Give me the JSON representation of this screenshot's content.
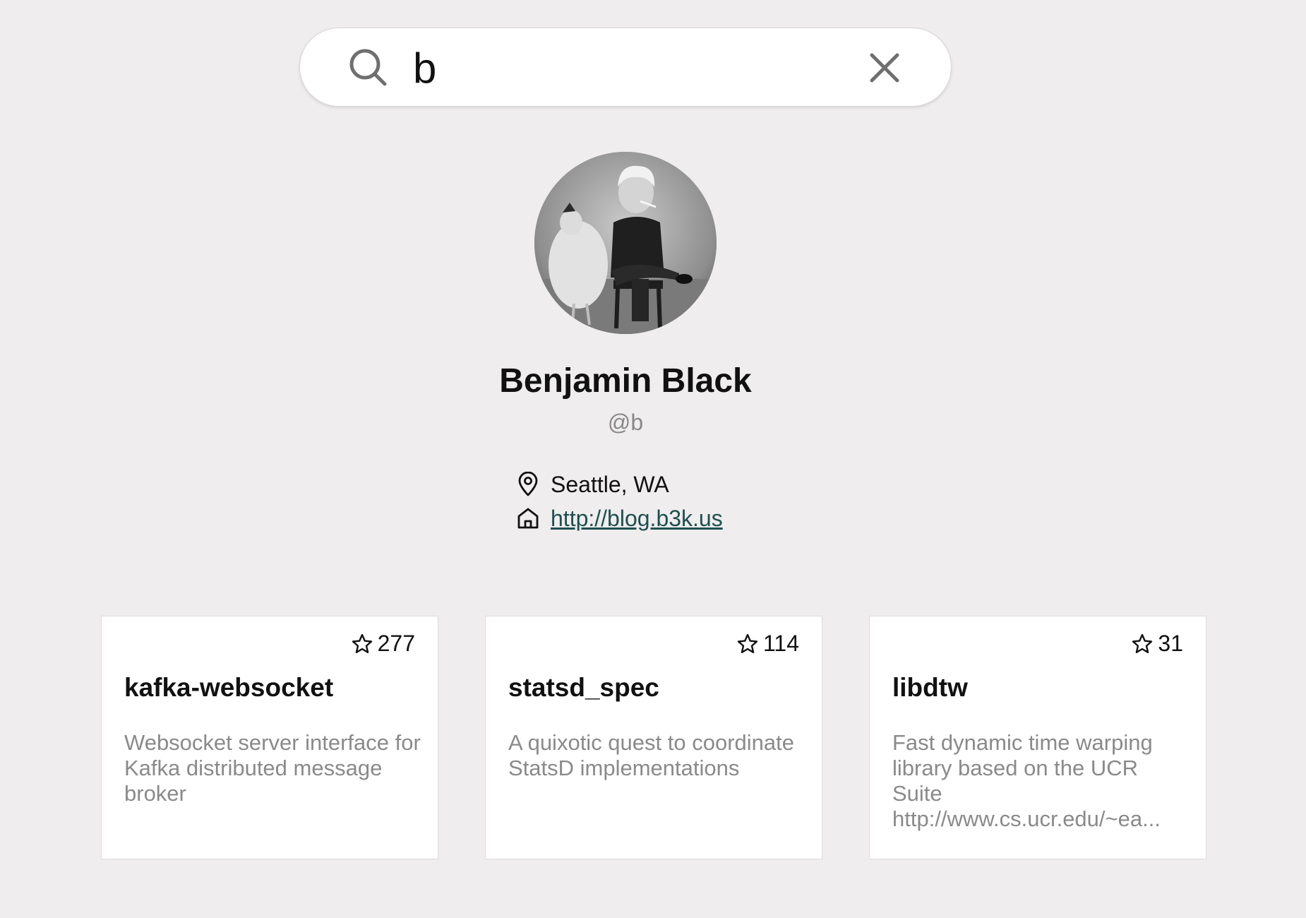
{
  "search": {
    "query": "b",
    "icon": "search-icon",
    "clear_icon": "close-icon"
  },
  "profile": {
    "avatar_icon": "avatar",
    "name": "Benjamin Black",
    "handle": "@b",
    "location": "Seattle, WA",
    "location_icon": "map-pin-icon",
    "website": "http://blog.b3k.us",
    "website_icon": "home-icon"
  },
  "repos": [
    {
      "stars": "277",
      "name": "kafka-websocket",
      "description": "Websocket server interface for Kafka distributed message broker"
    },
    {
      "stars": "114",
      "name": "statsd_spec",
      "description": "A quixotic quest to coordinate StatsD implementations"
    },
    {
      "stars": "31",
      "name": "libdtw",
      "description": "Fast dynamic time warping library based on the UCR Suite http://www.cs.ucr.edu/~ea..."
    }
  ],
  "colors": {
    "background": "#efedee",
    "link": "#1f4f4f",
    "muted_text": "#8a8a8a"
  }
}
